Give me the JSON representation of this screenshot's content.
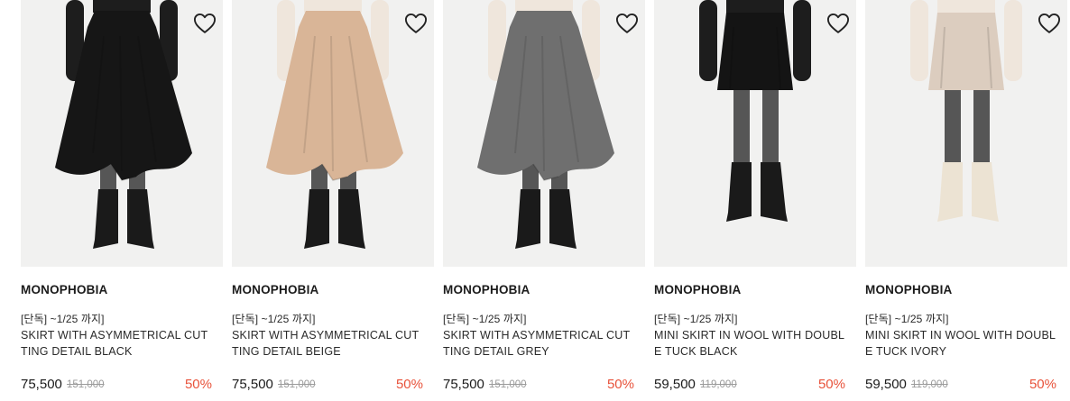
{
  "colors": {
    "discount": "#e8533b",
    "original_price": "#9a9a9a",
    "image_bg": "#f1f1f0"
  },
  "products": [
    {
      "brand": "MONOPHOBIA",
      "tag": "[단독] ~1/25 까지]",
      "title": "SKIRT WITH ASYMMETRICAL CUTTING DETAIL BLACK",
      "price": "75,500",
      "original_price": "151,000",
      "discount": "50%",
      "skirt_color": "#161616",
      "skirt_style": "asymmetric",
      "boot_color": "#1a1a1a",
      "wishlist_icon": "heart-outline-icon"
    },
    {
      "brand": "MONOPHOBIA",
      "tag": "[단독] ~1/25 까지]",
      "title": "SKIRT WITH ASYMMETRICAL CUTTING DETAIL BEIGE",
      "price": "75,500",
      "original_price": "151,000",
      "discount": "50%",
      "skirt_color": "#d9b597",
      "skirt_style": "asymmetric",
      "boot_color": "#1a1a1a",
      "wishlist_icon": "heart-outline-icon"
    },
    {
      "brand": "MONOPHOBIA",
      "tag": "[단독] ~1/25 까지]",
      "title": "SKIRT WITH ASYMMETRICAL CUTTING DETAIL GREY",
      "price": "75,500",
      "original_price": "151,000",
      "discount": "50%",
      "skirt_color": "#6f6f6f",
      "skirt_style": "asymmetric",
      "boot_color": "#1a1a1a",
      "wishlist_icon": "heart-outline-icon"
    },
    {
      "brand": "MONOPHOBIA",
      "tag": "[단독] ~1/25 까지]",
      "title": "MINI SKIRT IN WOOL WITH DOUBLE TUCK BLACK",
      "price": "59,500",
      "original_price": "119,000",
      "discount": "50%",
      "skirt_color": "#141414",
      "skirt_style": "mini",
      "boot_color": "#1a1a1a",
      "wishlist_icon": "heart-outline-icon"
    },
    {
      "brand": "MONOPHOBIA",
      "tag": "[단독] ~1/25 까지]",
      "title": "MINI SKIRT IN WOOL WITH DOUBLE TUCK IVORY",
      "price": "59,500",
      "original_price": "119,000",
      "discount": "50%",
      "skirt_color": "#dccdbf",
      "skirt_style": "mini",
      "boot_color": "#ece3d3",
      "wishlist_icon": "heart-outline-icon"
    }
  ]
}
